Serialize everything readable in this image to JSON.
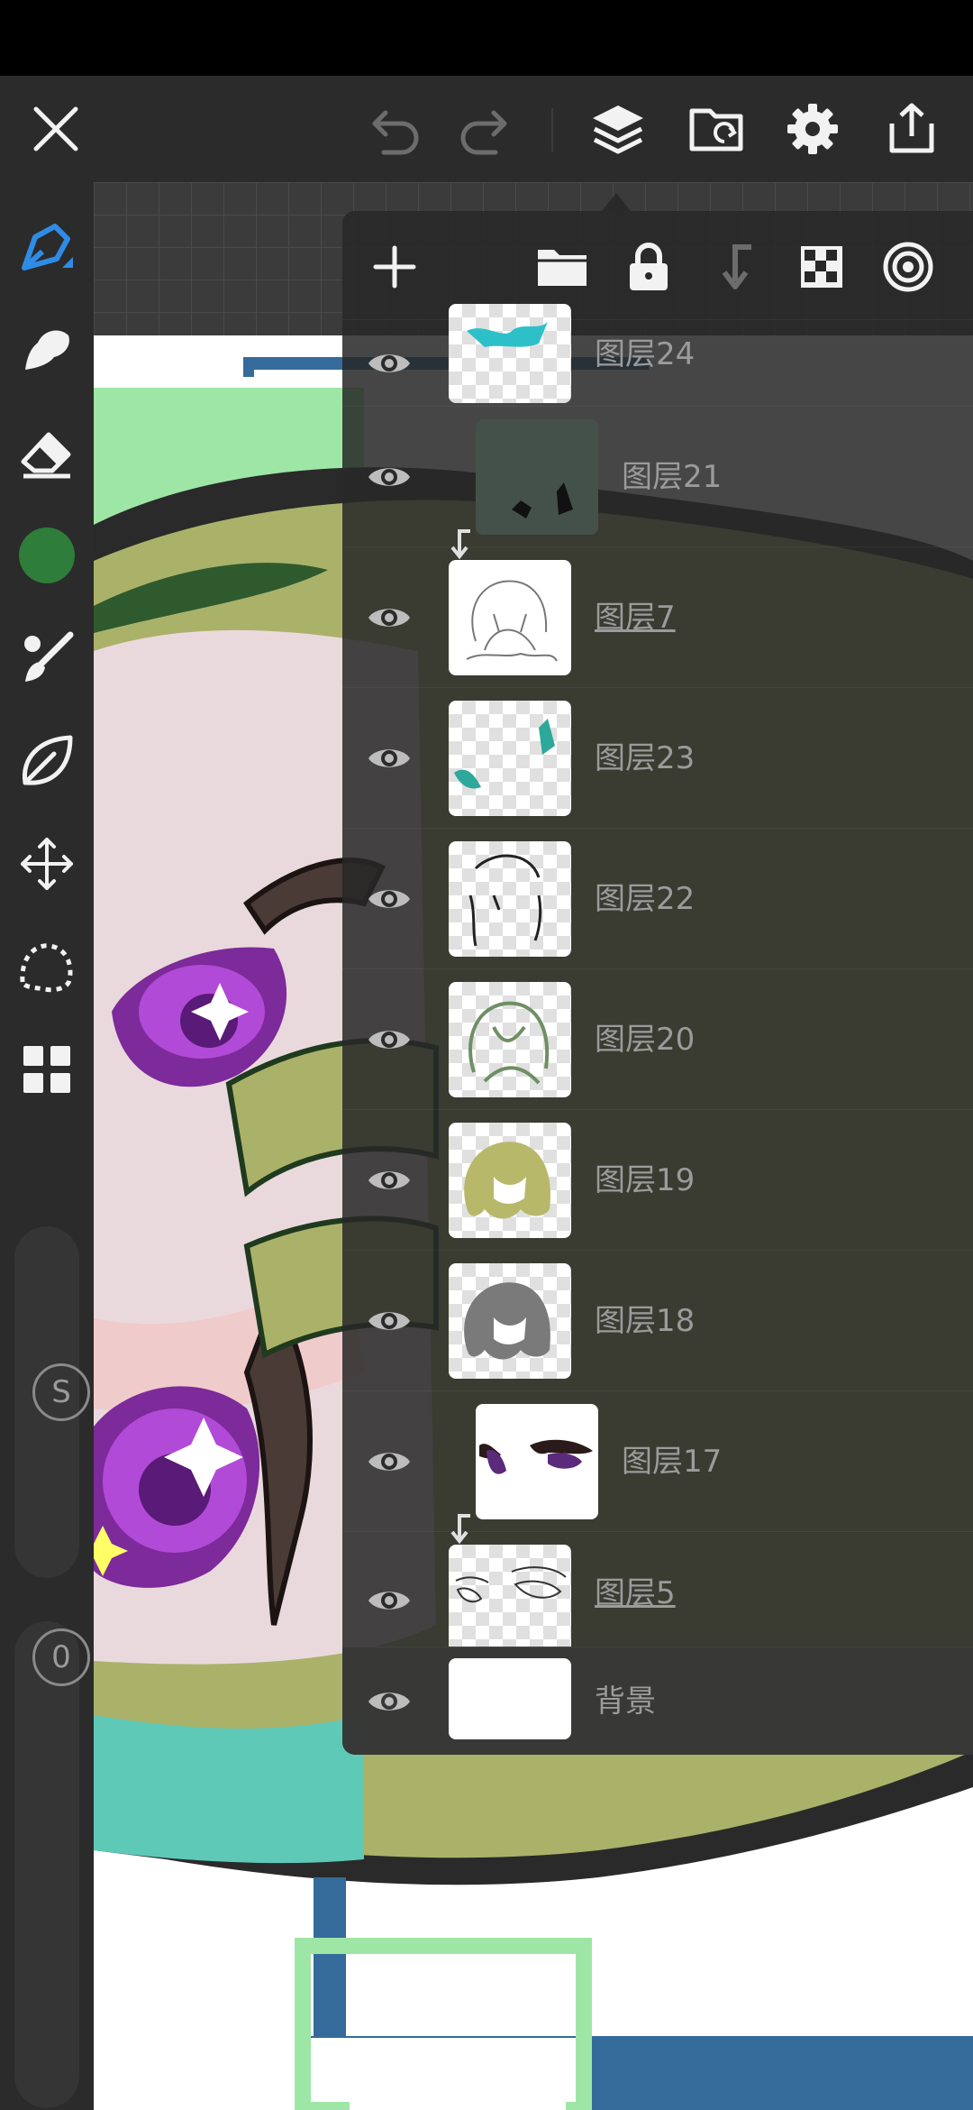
{
  "layers": [
    {
      "name": "图层24",
      "clipped": false,
      "underlined": false
    },
    {
      "name": "图层21",
      "clipped": true,
      "underlined": false
    },
    {
      "name": "图层7",
      "clipped": false,
      "underlined": true
    },
    {
      "name": "图层23",
      "clipped": false,
      "underlined": false
    },
    {
      "name": "图层22",
      "clipped": false,
      "underlined": false
    },
    {
      "name": "图层20",
      "clipped": false,
      "underlined": false
    },
    {
      "name": "图层19",
      "clipped": false,
      "underlined": false
    },
    {
      "name": "图层18",
      "clipped": false,
      "underlined": false
    },
    {
      "name": "图层17",
      "clipped": true,
      "underlined": false
    },
    {
      "name": "图层5",
      "clipped": false,
      "underlined": true
    },
    {
      "name": "背景",
      "clipped": false,
      "underlined": false
    }
  ],
  "left_toolbar": {
    "current_color": "#2e7d3a",
    "size_slider_label": "S",
    "opacity_slider_label": "0"
  },
  "colors": {
    "accent_blue": "#2f8ce6",
    "toolbar_bg": "#2b2b2b",
    "icon_white": "#f2f2f2",
    "icon_gray": "#7a7a7a"
  },
  "icons": {
    "top_bar": [
      "close-icon",
      "undo-icon",
      "redo-icon",
      "layers-icon",
      "import-icon",
      "settings-icon",
      "share-icon"
    ],
    "layers_toolbar": [
      "add-icon",
      "folder-icon",
      "lock-icon",
      "clip-icon",
      "transparency-icon",
      "blend-icon"
    ],
    "tools": [
      "pen-icon",
      "smudge-icon",
      "eraser-icon",
      "color-icon",
      "brush-icon",
      "leaf-icon",
      "move-icon",
      "lasso-icon",
      "grid-icon"
    ]
  }
}
